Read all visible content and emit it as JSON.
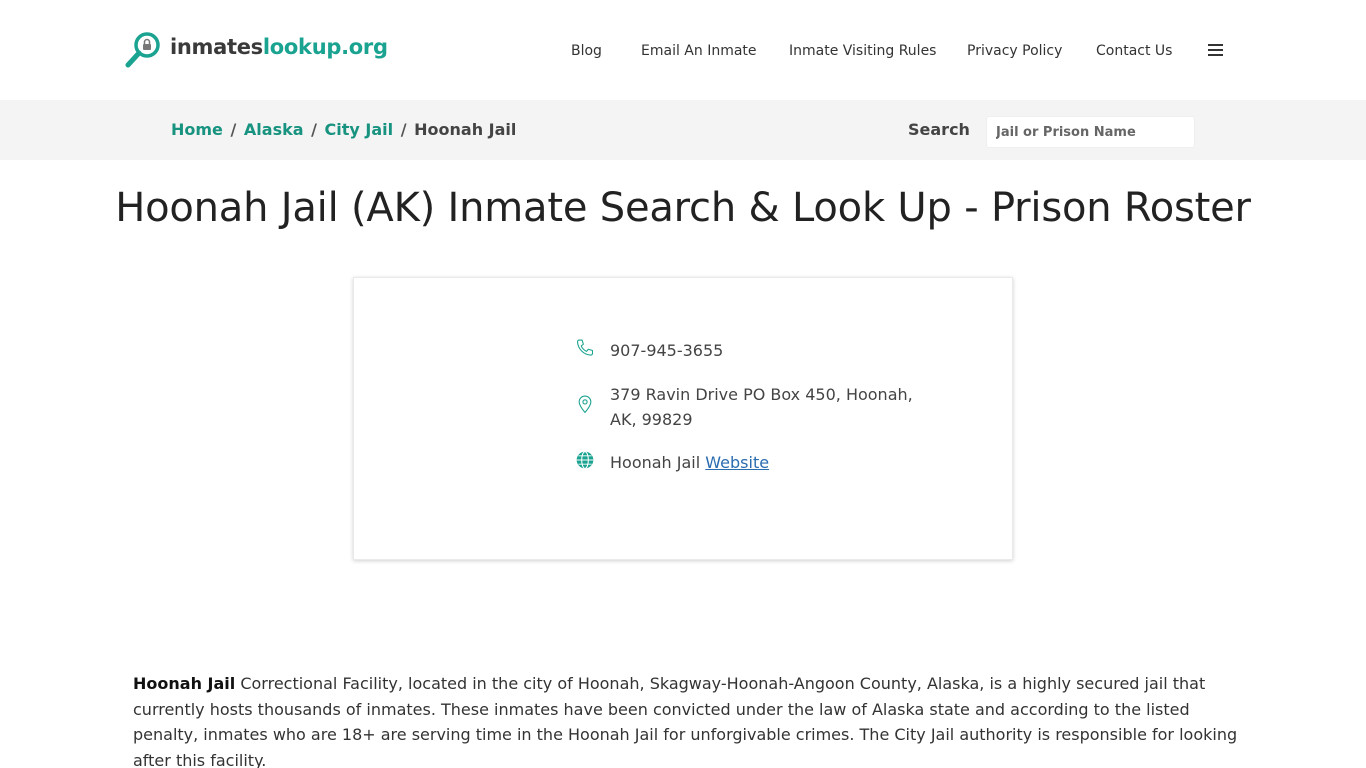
{
  "logo": {
    "part1": "inmates",
    "part2": "lookup.org"
  },
  "nav": {
    "blog": "Blog",
    "email": "Email An Inmate",
    "visiting": "Inmate Visiting Rules",
    "privacy": "Privacy Policy",
    "contact": "Contact Us"
  },
  "breadcrumb": {
    "home": "Home",
    "state": "Alaska",
    "category": "City Jail",
    "current": "Hoonah Jail",
    "separator": "/"
  },
  "search": {
    "label": "Search",
    "placeholder": "Jail or Prison Name"
  },
  "page_title": "Hoonah Jail (AK) Inmate Search & Look Up - Prison Roster",
  "card": {
    "phone": "907-945-3655",
    "address": "379 Ravin Drive PO Box 450, Hoonah, AK, 99829",
    "website_prefix": "Hoonah Jail",
    "website_link": "Website",
    "icons": [
      "phone-icon",
      "map-pin-icon",
      "globe-icon"
    ]
  },
  "description": {
    "name": "Hoonah Jail",
    "text": " Correctional Facility, located in the city of Hoonah, Skagway-Hoonah-Angoon County, Alaska, is a highly secured jail that currently hosts thousands of inmates. These inmates have been convicted under the law of Alaska state and according to the listed penalty, inmates who are 18+ are serving time in the Hoonah Jail for unforgivable crimes. The City Jail authority is responsible for looking after this facility."
  },
  "colors": {
    "brand": "#1aa390",
    "link": "#17937f",
    "breadcrumb_bg": "#f4f4f4"
  }
}
